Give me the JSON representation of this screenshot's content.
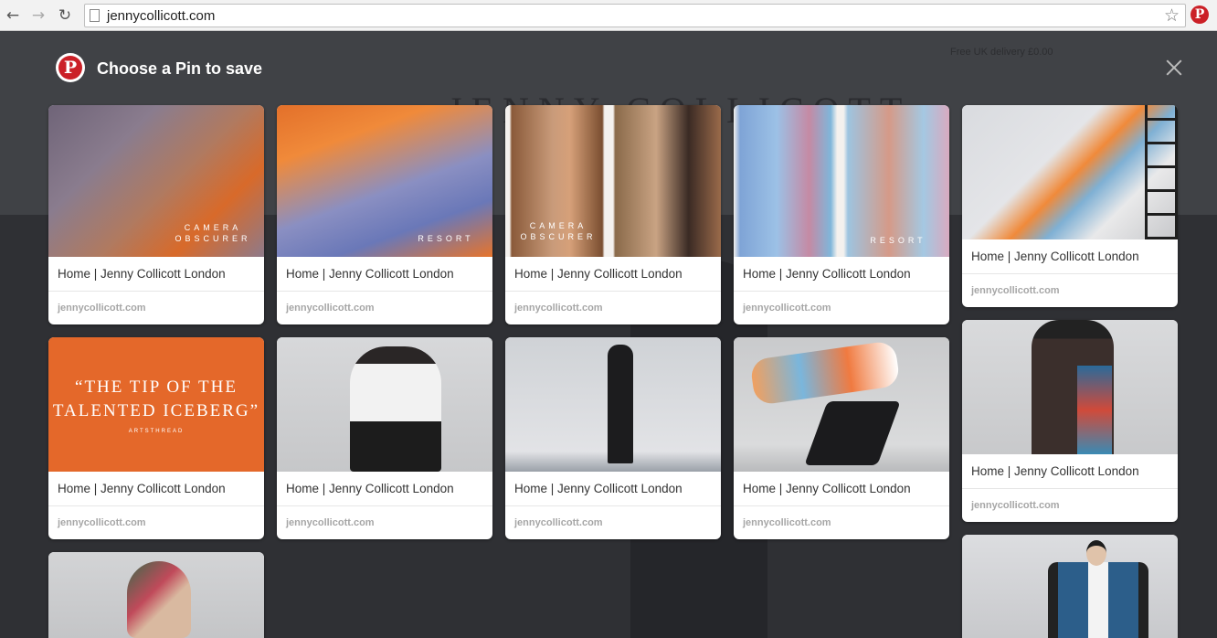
{
  "browser": {
    "url": "jennycollicott.com",
    "back_icon": "back-arrow-icon",
    "forward_icon": "forward-arrow-icon",
    "reload_icon": "reload-icon",
    "star_icon": "bookmark-star-icon",
    "extension_icon": "pinterest-extension-icon"
  },
  "background_page": {
    "logo": "JENNY COLLICOTT",
    "shipping": "Free UK delivery £0.00"
  },
  "modal": {
    "title": "Choose a Pin to save",
    "brand_color": "#cb2027"
  },
  "thumb_text": {
    "camera_obscurer": "CAMERA OBSCURER",
    "resort": "RESORT",
    "quote": "“THE TIP OF THE TALENTED ICEBERG”",
    "quote_source": "ARTSTHREAD"
  },
  "pins": [
    {
      "title": "Home | Jenny Collicott London",
      "domain": "jennycollicott.com"
    },
    {
      "title": "Home | Jenny Collicott London",
      "domain": "jennycollicott.com"
    },
    {
      "title": "Home | Jenny Collicott London",
      "domain": "jennycollicott.com"
    },
    {
      "title": "Home | Jenny Collicott London",
      "domain": "jennycollicott.com"
    },
    {
      "title": "Home | Jenny Collicott London",
      "domain": "jennycollicott.com"
    },
    {
      "title": "Home | Jenny Collicott London",
      "domain": "jennycollicott.com"
    },
    {
      "title": "Home | Jenny Collicott London",
      "domain": "jennycollicott.com"
    },
    {
      "title": "Home | Jenny Collicott London",
      "domain": "jennycollicott.com"
    },
    {
      "title": "Home | Jenny Collicott London",
      "domain": "jennycollicott.com"
    },
    {
      "title": "Home | Jenny Collicott London",
      "domain": "jennycollicott.com"
    }
  ]
}
